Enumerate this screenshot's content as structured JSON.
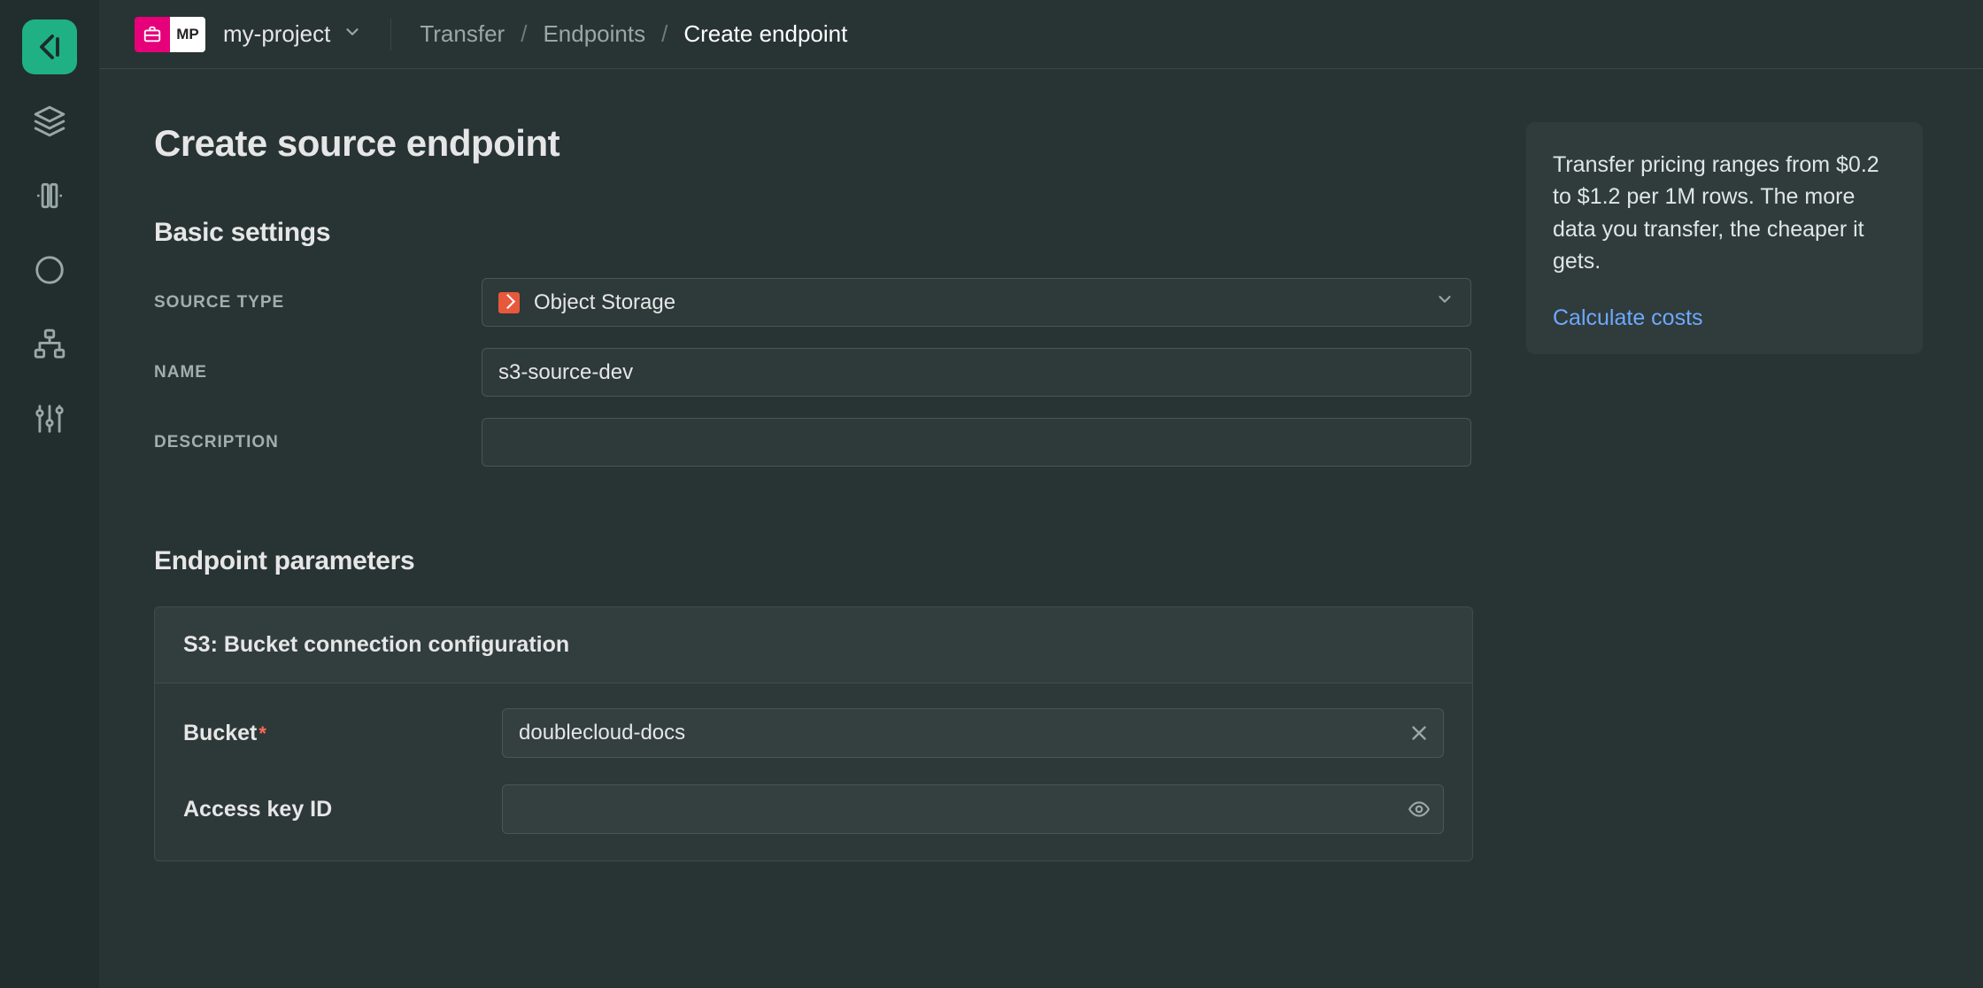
{
  "topbar": {
    "project_abbrev": "MP",
    "project_name": "my-project",
    "breadcrumbs": [
      {
        "label": "Transfer",
        "active": false
      },
      {
        "label": "Endpoints",
        "active": false
      },
      {
        "label": "Create endpoint",
        "active": true
      }
    ]
  },
  "page": {
    "title": "Create source endpoint",
    "basic_settings": {
      "heading": "Basic settings",
      "source_type": {
        "label": "Source type",
        "value": "Object Storage"
      },
      "name": {
        "label": "Name",
        "value": "s3-source-dev"
      },
      "description": {
        "label": "Description",
        "value": ""
      }
    },
    "endpoint_params": {
      "heading": "Endpoint parameters",
      "card": {
        "header": "S3: Bucket connection configuration",
        "rows": {
          "bucket": {
            "label": "Bucket",
            "required": true,
            "value": "doublecloud-docs"
          },
          "access_key_id": {
            "label": "Access key ID",
            "value": ""
          }
        }
      }
    }
  },
  "info_panel": {
    "text": "Transfer pricing ranges from $0.2 to $1.2 per 1M rows. The more data you transfer, the cheaper it gets.",
    "link_text": "Calculate costs"
  }
}
